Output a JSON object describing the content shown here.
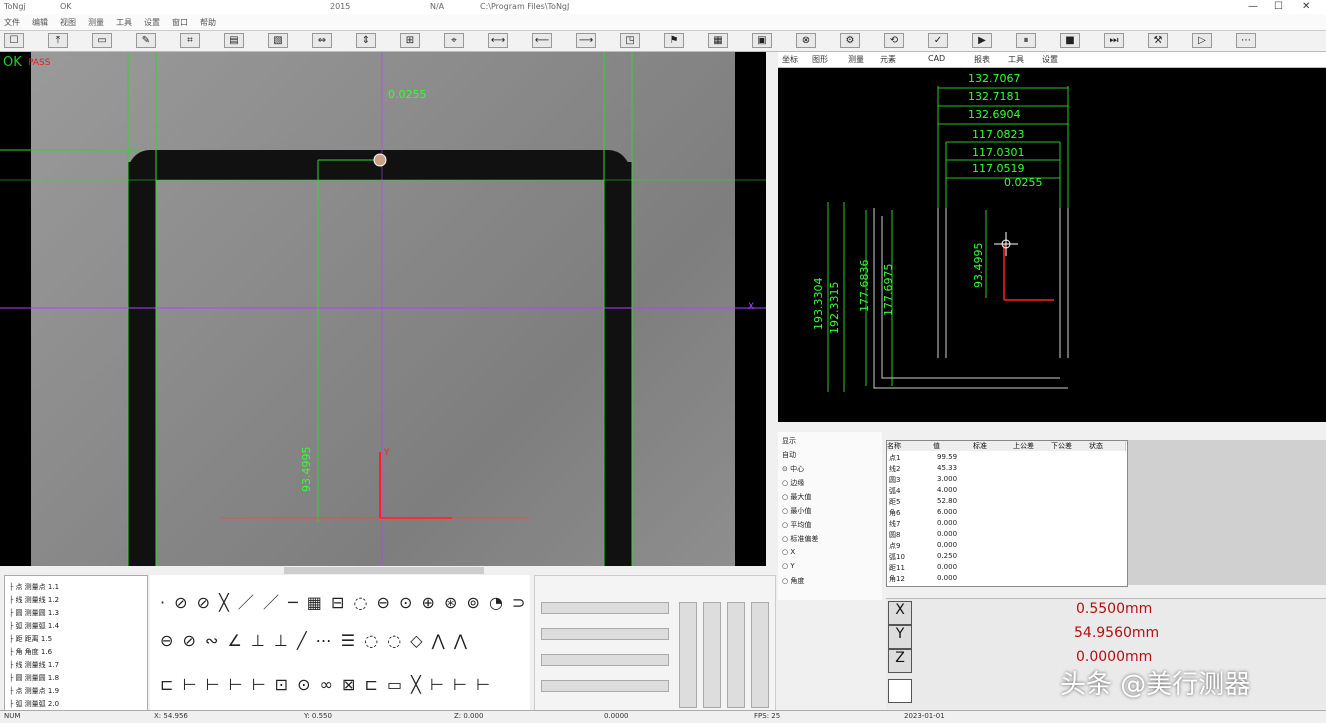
{
  "titlebar": {
    "app": "ToNgj",
    "segments": [
      "OK",
      "2015",
      "N/A",
      "C:\\Program Files\\ToNgJ"
    ],
    "min": "—",
    "max": "☐",
    "close": "✕"
  },
  "menubar": {
    "items": [
      "文件",
      "编辑",
      "视图",
      "测量",
      "工具",
      "设置",
      "窗口",
      "帮助"
    ]
  },
  "toolbar": {
    "icons": [
      "☐",
      "⤒",
      "▭",
      "✎",
      "⌗",
      "▤",
      "▧",
      "⇔",
      "⇕",
      "⊞",
      "⌖",
      "⟷",
      "⟵",
      "⟶",
      "◳",
      "⚑",
      "▦",
      "▣",
      "⊗",
      "⚙",
      "⟲",
      "✓",
      "▶",
      "⏸",
      "■",
      "⏭",
      "⚒",
      "▷",
      "⋯"
    ]
  },
  "camera": {
    "status": "OK",
    "status_tag": "PASS",
    "measure_top": "0.0255",
    "measure_vertical": "93.4995",
    "x_marker": "X",
    "y_marker": "Y"
  },
  "cad": {
    "tabs": [
      "坐标",
      "图形",
      "测量",
      "元素",
      "CAD",
      "报表",
      "工具",
      "设置"
    ],
    "dims_top": [
      "132.7067",
      "132.7181",
      "132.6904",
      "117.0823",
      "117.0301",
      "117.0519",
      "0.0255"
    ],
    "dims_left": [
      "193.3304",
      "192.3315",
      "177.6836",
      "177.6975",
      "93.4995"
    ]
  },
  "tree": {
    "rows": [
      "点 测量点 1.1",
      "线 测量线 1.2",
      "圆 测量圆 1.3",
      "弧 测量弧 1.4",
      "距 距离 1.5",
      "角 角度 1.6",
      "线 测量线 1.7",
      "圆 测量圆 1.8",
      "点 测量点 1.9",
      "弧 测量弧 2.0"
    ]
  },
  "tools": {
    "row1": "· ⊘ ⊘ ╳ ／ ／ ─ ▦ ⊟ ◌ ⊖ ⊙ ⊕ ⊛ ⊚ ◔ ⊃ ⊃ ⊙",
    "row2": "⊖ ⊘ ∾ ∠ ⊥ ⊥ ╱ ⋯ ☰ ◌ ◌ ◇ ⋀ ⋀",
    "row3": "⊏ ⊢ ⊢ ⊢ ⊢ ⊡ ⊙ ∞ ⊠ ⊏ ▭ ╳ ⊢ ⊢ ⊢"
  },
  "options": {
    "items": [
      "显示",
      "自动",
      "⊙ 中心",
      "○ 边缘",
      "○ 最大值",
      "○ 最小值",
      "○ 平均值",
      "○ 标准偏差",
      "○ X",
      "○ Y",
      "○ 角度"
    ]
  },
  "results": {
    "headers": [
      "名称",
      "值",
      "标准",
      "上公差",
      "下公差",
      "状态"
    ],
    "rows": [
      [
        "点1",
        "99.59"
      ],
      [
        "线2",
        "45.33"
      ],
      [
        "圆3",
        "3.000"
      ],
      [
        "弧4",
        "4.000"
      ],
      [
        "距5",
        "52.80"
      ],
      [
        "角6",
        "6.000"
      ],
      [
        "线7",
        "0.000"
      ],
      [
        "圆8",
        "0.000"
      ],
      [
        "点9",
        "0.000"
      ],
      [
        "弧10",
        "0.250"
      ],
      [
        "距11",
        "0.000"
      ],
      [
        "角12",
        "0.000"
      ]
    ]
  },
  "readout": {
    "x": "0.5500mm",
    "y": "54.9560mm",
    "z": "0.0000mm"
  },
  "statusbar": {
    "items": [
      "NUM",
      "X: 54.956",
      "Y: 0.550",
      "Z: 0.000",
      "0.0000",
      "FPS: 25",
      "2023-01-01"
    ]
  },
  "watermark": "头条 @美行测器",
  "colors": {
    "measure_green": "#33ff33",
    "readout_red": "#b31010",
    "axis_red": "#ff2020",
    "axis_purple": "#b040ff"
  }
}
